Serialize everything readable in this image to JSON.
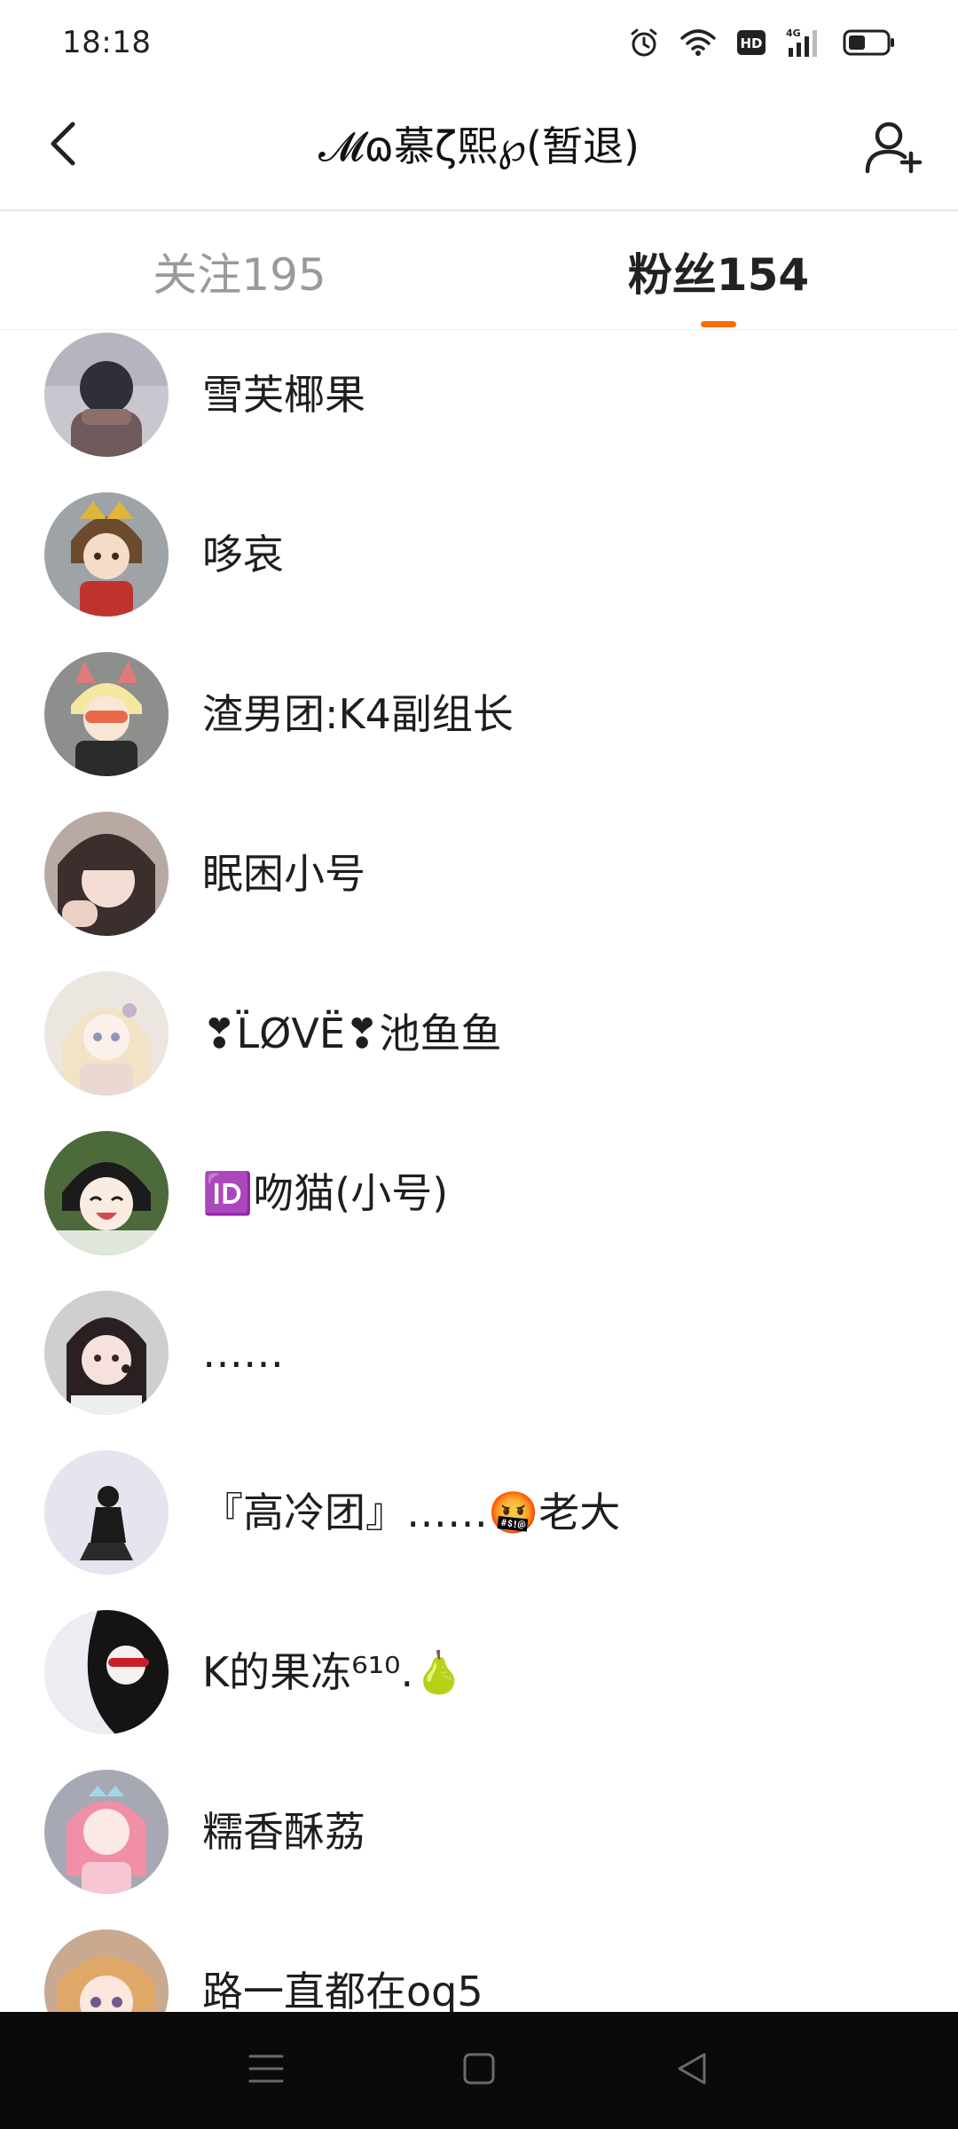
{
  "status_bar": {
    "time": "18:18",
    "icons": [
      "alarm-icon",
      "wifi-icon",
      "hd-icon",
      "signal-4g-icon",
      "battery-icon"
    ],
    "hd_label": "HD",
    "network_label": "4G"
  },
  "header": {
    "title": "𝓜ɷ慕ζ熙℘(暂退)",
    "back_icon": "chevron-left-icon",
    "add_icon": "add-user-icon"
  },
  "tabs": [
    {
      "label": "关注195",
      "active": false
    },
    {
      "label": "粉丝154",
      "active": true
    }
  ],
  "accent_color": "#ff6a00",
  "followers": [
    {
      "name": "雪芙椰果"
    },
    {
      "name": "哆哀"
    },
    {
      "name": "渣男团:K4副组长"
    },
    {
      "name": "眠困小号"
    },
    {
      "name": "❣L̈ØVË❣池鱼鱼"
    },
    {
      "name": "🆔吻猫(小号)"
    },
    {
      "name": "……"
    },
    {
      "name": "『高冷团』……🤬老大"
    },
    {
      "name": "K的果冻⁶¹⁰.🍐"
    },
    {
      "name": "糯香酥荔"
    },
    {
      "name": "路一直都在oq5"
    }
  ],
  "nav_bar": [
    "menu-icon",
    "home-icon",
    "back-triangle-icon"
  ]
}
